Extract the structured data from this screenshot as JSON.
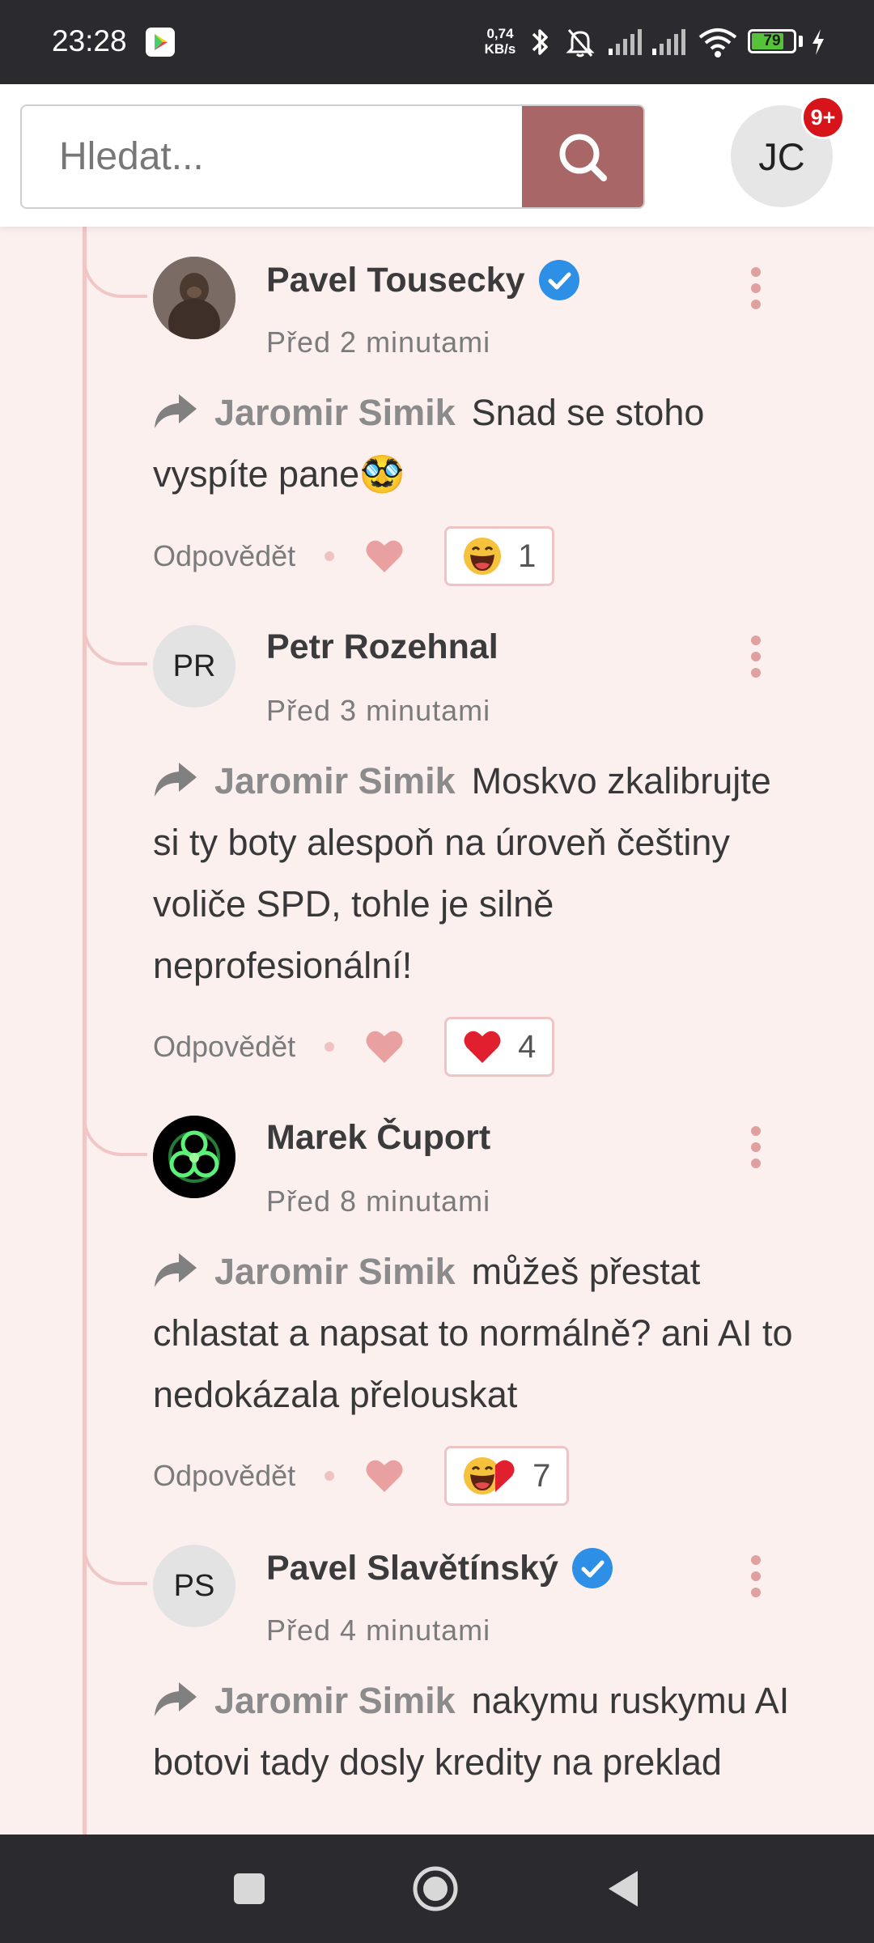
{
  "status_bar": {
    "time": "23:28",
    "net_speed_value": "0,74",
    "net_speed_unit": "KB/s",
    "battery": "79"
  },
  "header": {
    "search_placeholder": "Hledat...",
    "user_initials": "JC",
    "notification_badge": "9+"
  },
  "comments": [
    {
      "author": "Pavel Tousecky",
      "verified": true,
      "time": "Před 2 minutami",
      "reply_to": "Jaromir Simik",
      "text": "Snad se stoho vyspíte pane🥸",
      "reply_label": "Odpovědět",
      "reaction_count": "1"
    },
    {
      "author": "Petr Rozehnal",
      "initials": "PR",
      "verified": false,
      "time": "Před 3 minutami",
      "reply_to": "Jaromir Simik",
      "text": "Moskvo zkalibrujte si ty boty alespoň na úroveň češtiny voliče SPD, tohle je silně neprofesionální!",
      "reply_label": "Odpovědět",
      "reaction_count": "4"
    },
    {
      "author": "Marek Čuport",
      "verified": false,
      "time": "Před 8 minutami",
      "reply_to": "Jaromir Simik",
      "text": "můžeš přestat chlastat a napsat to normálně? ani AI to nedokázala přelouskat",
      "reply_label": "Odpovědět",
      "reaction_count": "7"
    },
    {
      "author": "Pavel Slavětínský",
      "initials": "PS",
      "verified": true,
      "time": "Před 4 minutami",
      "reply_to": "Jaromir Simik",
      "text": "nakymu ruskymu AI botovi tady dosly kredity na preklad"
    }
  ],
  "colors": {
    "search_button": "#a86667",
    "background": "#fcf0ef",
    "thread_line": "#f1c6c6",
    "verified": "#2e8fe6",
    "like": "#e8a0a0",
    "heart": "#e0202e"
  },
  "icons": [
    "search-icon",
    "verified-icon",
    "more-vert-icon",
    "reply-arrow-icon",
    "heart-icon",
    "laughing-emoji-icon"
  ]
}
